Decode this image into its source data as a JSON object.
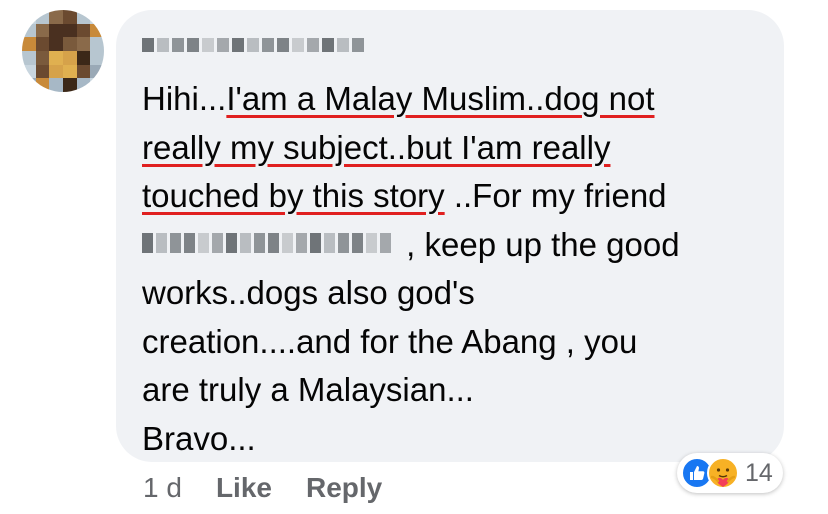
{
  "comment": {
    "author_name": "",
    "lines": [
      {
        "pre": "Hihi...",
        "hl": "I'am a Malay Muslim..dog not",
        "post": ""
      },
      {
        "pre": "",
        "hl": "really my subject..but I'am really",
        "post": ""
      },
      {
        "pre": "",
        "hl": "touched by this story",
        "post": " ..For my friend"
      },
      {
        "mention": "",
        "post": " , keep up the good"
      },
      {
        "text": "works..dogs also god's"
      },
      {
        "text": "creation....and for the Abang , you"
      },
      {
        "text": "are truly a Malaysian..."
      },
      {
        "text": "Bravo..."
      }
    ]
  },
  "meta": {
    "time": "1 d",
    "like_label": "Like",
    "reply_label": "Reply"
  },
  "reactions": {
    "icons": [
      "like-icon",
      "care-icon"
    ],
    "count": "14"
  },
  "colors": {
    "bubble": "#f0f2f5",
    "underline": "#e02020",
    "text": "#050505",
    "meta": "#65676b",
    "like_blue": "#1877f2",
    "care_yellow": "#f7b125"
  }
}
